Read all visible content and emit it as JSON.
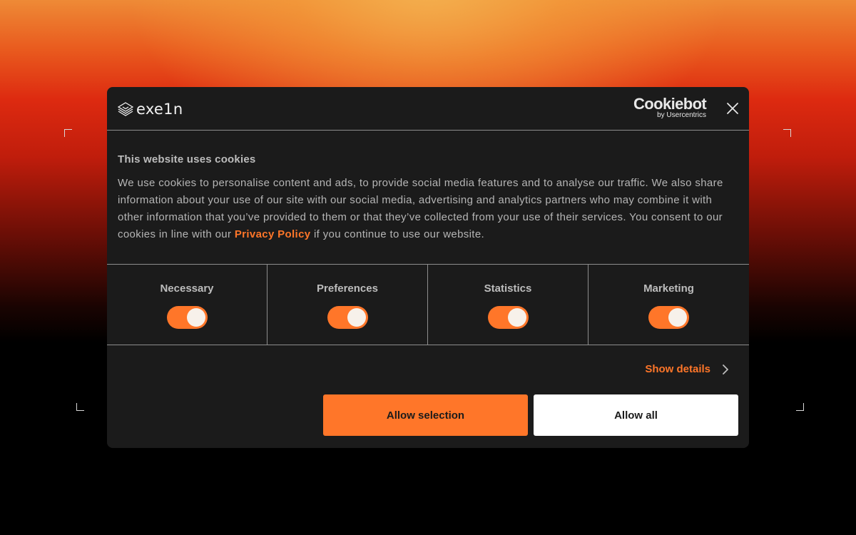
{
  "brand": {
    "logo_text": "exe1n",
    "accent_color": "#ff7629"
  },
  "provider": {
    "name": "Cookiebot",
    "byline": "by Usercentrics"
  },
  "dialog": {
    "title": "This website uses cookies",
    "text_before_link": "We use cookies to personalise content and ads, to provide social media features and to analyse our traffic. We also share information about your use of our site with our social media, advertising and analytics partners who may combine it with other information that you’ve provided to them or that they’ve collected from your use of their services. You consent to our cookies in line with our ",
    "link_label": "Privacy Policy",
    "text_after_link": " if you continue to use our website."
  },
  "categories": [
    {
      "label": "Necessary",
      "enabled": true
    },
    {
      "label": "Preferences",
      "enabled": true
    },
    {
      "label": "Statistics",
      "enabled": true
    },
    {
      "label": "Marketing",
      "enabled": true
    }
  ],
  "actions": {
    "show_details_label": "Show details",
    "allow_selection_label": "Allow selection",
    "allow_all_label": "Allow all"
  },
  "icons": {
    "close": "close-icon",
    "show_details": "chevron-right-icon",
    "logo": "exein-logo-icon"
  }
}
